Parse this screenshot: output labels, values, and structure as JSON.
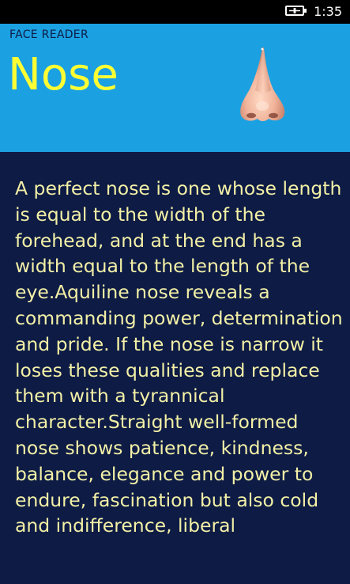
{
  "status_bar": {
    "time": "1:35",
    "battery_icon": "battery-charging-icon"
  },
  "header": {
    "app_title": "FACE READER",
    "page_title": "Nose",
    "image_icon": "nose-icon",
    "background_color": "#1ba1e2",
    "title_color": "#ffff33"
  },
  "content": {
    "description": "A perfect nose is one whose length is equal to the width of the forehead, and at the end has a width equal to the length of the eye.Aquiline nose reveals a commanding power, determination and pride. If the nose is narrow it loses these qualities and replace them with a tyrannical character.Straight well-formed nose shows patience, kindness, balance, elegance and power to endure, fascination but also cold and indifference, liberal",
    "background_color": "#0d1b45",
    "text_color": "#f3f0a6"
  }
}
